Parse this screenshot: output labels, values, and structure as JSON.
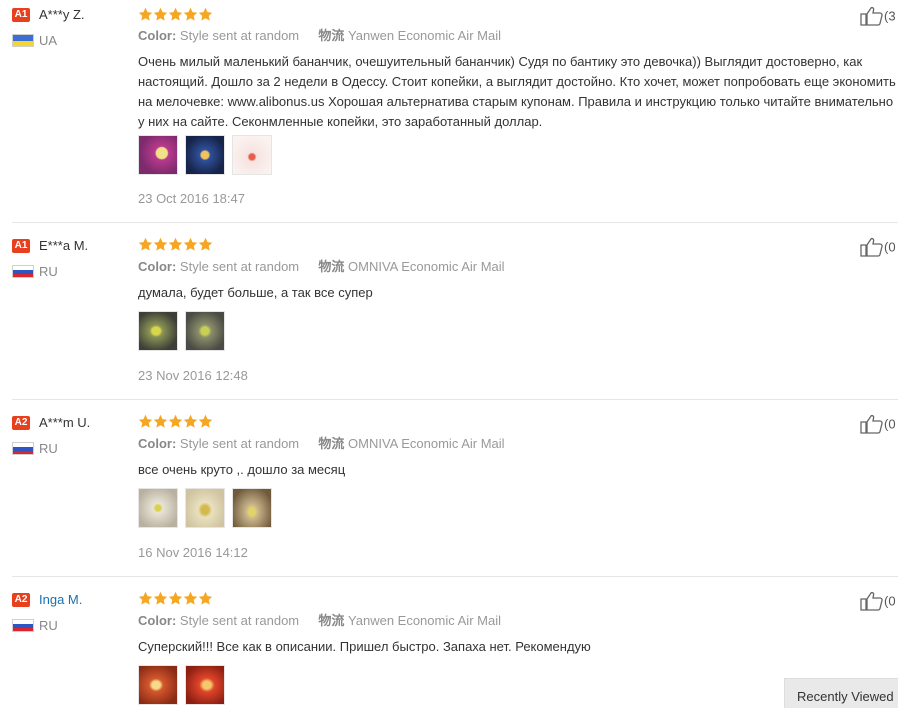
{
  "labels": {
    "color_key": "Color:",
    "shipping_key": "物流"
  },
  "reviews": [
    {
      "level": "A1",
      "name": "A***y Z.",
      "country": "UA",
      "flag_colors": [
        "#3b6fd1",
        "#f6d52c"
      ],
      "rating": 5,
      "color": "Style sent at random",
      "shipping": "Yanwen Economic Air Mail",
      "text": "Очень милый маленький бананчик, очешуительный бананчик) Судя по бантику это девочка)) Выглядит достоверно, как настоящий. Дошло за 2 недели в Одессу. Стоит копейки, а выглядит достойно. Кто хочет, может попробовать еще экономить на мелочевке: www.alibonus.us Хорошая альтернатива старым купонам. Правила и инструкцию только читайте внимательно у них на сайте. Секонмленные копейки, это заработанный доллар.",
      "photos": [
        "photo-1",
        "photo-2",
        "photo-3"
      ],
      "date": "23 Oct 2016 18:47",
      "likes": "(3"
    },
    {
      "level": "A1",
      "name": "E***a M.",
      "country": "RU",
      "flag_colors": [
        "#ffffff",
        "#2f55c4",
        "#d8262e"
      ],
      "rating": 5,
      "color": "Style sent at random",
      "shipping": "OMNIVA Economic Air Mail",
      "text": "думала, будет больше, а так все супер",
      "photos": [
        "photo-1",
        "photo-2"
      ],
      "date": "23 Nov 2016 12:48",
      "likes": "(0"
    },
    {
      "level": "A2",
      "name": "A***m U.",
      "country": "RU",
      "flag_colors": [
        "#ffffff",
        "#2f55c4",
        "#d8262e"
      ],
      "rating": 5,
      "color": "Style sent at random",
      "shipping": "OMNIVA Economic Air Mail",
      "text": "все очень круто ,. дошло за месяц",
      "photos": [
        "photo-1",
        "photo-2",
        "photo-3"
      ],
      "date": "16 Nov 2016 14:12",
      "likes": "(0"
    },
    {
      "level": "A2",
      "name": "Inga M.",
      "country": "RU",
      "flag_colors": [
        "#ffffff",
        "#2f55c4",
        "#d8262e"
      ],
      "rating": 5,
      "color": "Style sent at random",
      "shipping": "Yanwen Economic Air Mail",
      "text": "Суперский!!! Все как в описании. Пришел быстро. Запаха нет. Рекомендую",
      "photos": [
        "photo-1",
        "photo-2"
      ],
      "date": "",
      "likes": "(0"
    }
  ],
  "recently_viewed": "Recently Viewed",
  "colors": {
    "star": "#f5a623",
    "badge": "#e8401e",
    "link": "#1a6fb0"
  }
}
